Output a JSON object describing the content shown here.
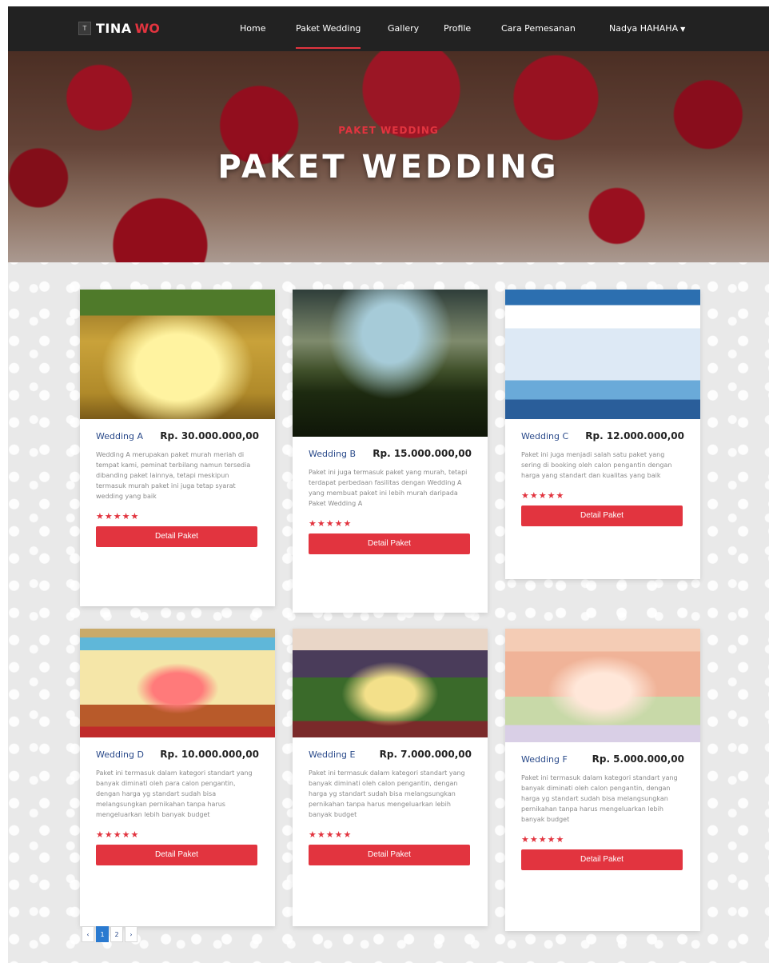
{
  "navbar": {
    "brand_mark": "T",
    "brand_name": "TINA",
    "brand_accent": "WO",
    "links": [
      {
        "label": "Home"
      },
      {
        "label": "Paket Wedding"
      },
      {
        "label": "Gallery"
      },
      {
        "label": "Profile"
      },
      {
        "label": "Cara Pemesanan"
      },
      {
        "label": "Nadya HAHAHA"
      }
    ],
    "active_link": "Paket Wedding"
  },
  "hero": {
    "subtitle": "PAKET WEDDING",
    "title": "PAKET WEDDING"
  },
  "packages": [
    {
      "name": "Wedding A",
      "price": "Rp. 30.000.000,00",
      "description": "Wedding A merupakan paket murah meriah di tempat kami, peminat terbilang namun tersedia dibanding paket lainnya, tetapi meskipun termasuk murah paket ini juga tetap syarat wedding yang baik",
      "stars": "★★★★★",
      "rating": 5,
      "button": "Detail Paket"
    },
    {
      "name": "Wedding B",
      "price": "Rp. 15.000.000,00",
      "description": "Paket ini juga termasuk paket yang murah, tetapi terdapat perbedaan fasilitas dengan Wedding A yang membuat paket ini lebih murah daripada Paket Wedding A",
      "stars": "★★★★★",
      "rating": 5,
      "button": "Detail Paket"
    },
    {
      "name": "Wedding C",
      "price": "Rp. 12.000.000,00",
      "description": "Paket ini juga menjadi salah satu paket yang sering di booking oleh calon pengantin dengan harga yang standart dan kualitas yang baik",
      "stars": "★★★★★",
      "rating": 5,
      "button": "Detail Paket"
    },
    {
      "name": "Wedding D",
      "price": "Rp. 10.000.000,00",
      "description": "Paket ini termasuk dalam kategori standart yang banyak diminati oleh para calon pengantin, dengan harga yg standart sudah bisa melangsungkan pernikahan tanpa harus mengeluarkan lebih banyak budget",
      "stars": "★★★★★",
      "rating": 5,
      "button": "Detail Paket"
    },
    {
      "name": "Wedding E",
      "price": "Rp. 7.000.000,00",
      "description": "Paket ini termasuk dalam kategori standart yang banyak diminati oleh calon pengantin, dengan harga yg standart sudah bisa melangsungkan pernikahan tanpa harus mengeluarkan lebih banyak budget",
      "stars": "★★★★★",
      "rating": 5,
      "button": "Detail Paket"
    },
    {
      "name": "Wedding F",
      "price": "Rp. 5.000.000,00",
      "description": "Paket ini termasuk dalam kategori standart yang banyak diminati oleh calon pengantin, dengan harga yg standart sudah bisa melangsungkan pernikahan tanpa harus mengeluarkan lebih banyak budget",
      "stars": "★★★★★",
      "rating": 5,
      "button": "Detail Paket"
    }
  ],
  "pagination": {
    "prev": "‹",
    "pages": [
      "1",
      "2"
    ],
    "next": "›",
    "current": "1"
  },
  "colors": {
    "accent": "#e2343f",
    "navbar_bg": "#222222",
    "link_blue": "#2a4a8a",
    "page_active": "#2a7ad0"
  }
}
